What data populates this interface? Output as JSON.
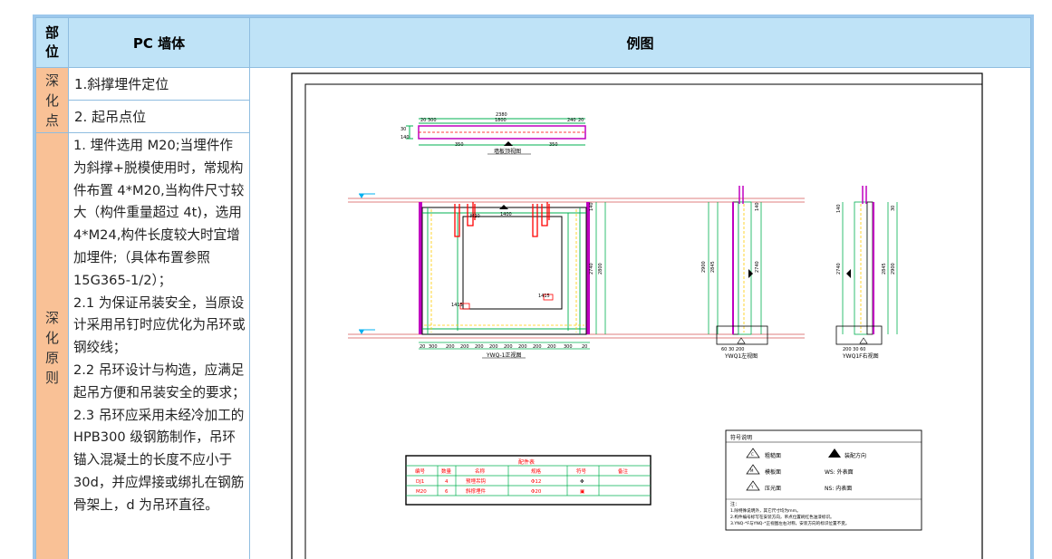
{
  "table": {
    "header": {
      "col_part": "部\n位",
      "col_pc": "PC 墙体",
      "col_example": "例图"
    },
    "section1": {
      "label": "深\n化\n点",
      "items": [
        "1.斜撑埋件定位",
        "2. 起吊点位"
      ]
    },
    "section2": {
      "label": "深\n化\n原\n则",
      "paragraphs": [
        "1. 埋件选用 M20;当埋件作为斜撑+脱模使用时，常规构件布置 4*M20,当构件尺寸较大（构件重量超过 4t)，选用 4*M24,构件长度较大时宜增加埋件;（具体布置参照 15G365-1/2）；",
        "2.1 为保证吊装安全，当原设计采用吊钉时应优化为吊环或钢绞线；",
        "2.2 吊环设计与构造，应满足起吊方便和吊装安全的要求；",
        "2.3 吊环应采用未经冷加工的 HPB300 级钢筋制作，吊环锚入混凝土的长度不应小于 30d，并应焊接或绑扎在钢筋骨架上，d 为吊环直径。"
      ]
    }
  },
  "drawing": {
    "top_view": {
      "title": "墙板顶视图",
      "dims_top": [
        "2380",
        "20",
        "300",
        "1800",
        "240",
        "20"
      ],
      "dims_bottom": [
        "350",
        "350"
      ],
      "dims_left": [
        "30",
        "140"
      ]
    },
    "front_view": {
      "title": "YWQ-1正视图",
      "dims_bottom": [
        "20",
        "300",
        "200",
        "200",
        "200",
        "200",
        "200",
        "200",
        "200",
        "200",
        "300",
        "20"
      ],
      "label_m20": "M20",
      "label_1400": "1400",
      "label_2740": "2740",
      "label_2800": "2800",
      "tag_a": "1415",
      "tag_b": "1415",
      "label_140": "140"
    },
    "left_view": {
      "title": "YWQ1左视图",
      "dims": [
        "2900",
        "2845",
        "2740",
        "140",
        "30",
        "60",
        "200"
      ],
      "bottom_dims": "60 30 200"
    },
    "right_view": {
      "title": "YWQ1F右视图",
      "dims": [
        "140",
        "2740",
        "2845",
        "2900",
        "30"
      ],
      "bottom_dims": "200 30 60"
    },
    "parts_table": {
      "title": "配件表",
      "headers": [
        "编号",
        "数量",
        "名称",
        "规格",
        "符号",
        "备注"
      ],
      "rows": [
        [
          "DJ1",
          "4",
          "预埋吊钩",
          "Φ12",
          "✥",
          ""
        ],
        [
          "M20",
          "6",
          "斜撑埋件",
          "Φ20",
          "▣",
          ""
        ]
      ]
    },
    "legend": {
      "title": "符号说明",
      "items": [
        {
          "sym": "C",
          "text": "粗糙面"
        },
        {
          "sym": "▲",
          "text": "装配方向"
        },
        {
          "sym": "M",
          "text": "模板面"
        },
        {
          "sym": "WS",
          "text": "WS: 外表面"
        },
        {
          "sym": "Y",
          "text": "压光面"
        },
        {
          "sym": "NS",
          "text": "NS: 内表面"
        }
      ],
      "notes_title": "注：",
      "notes": [
        "1.除特殊说明外，其它尺寸均为mm。",
        "2.构件编号标写在安装方向，吊点位置刷红色油漆标识。",
        "3.YNQ-*F与YNQ-*正视图左右对称，安装方向的标识位置不变。"
      ]
    },
    "colors": {
      "green": "#00b050",
      "magenta": "#c000c0",
      "red": "#ff0000",
      "yellow": "#ffff00",
      "cyan": "#00b0f0"
    }
  }
}
